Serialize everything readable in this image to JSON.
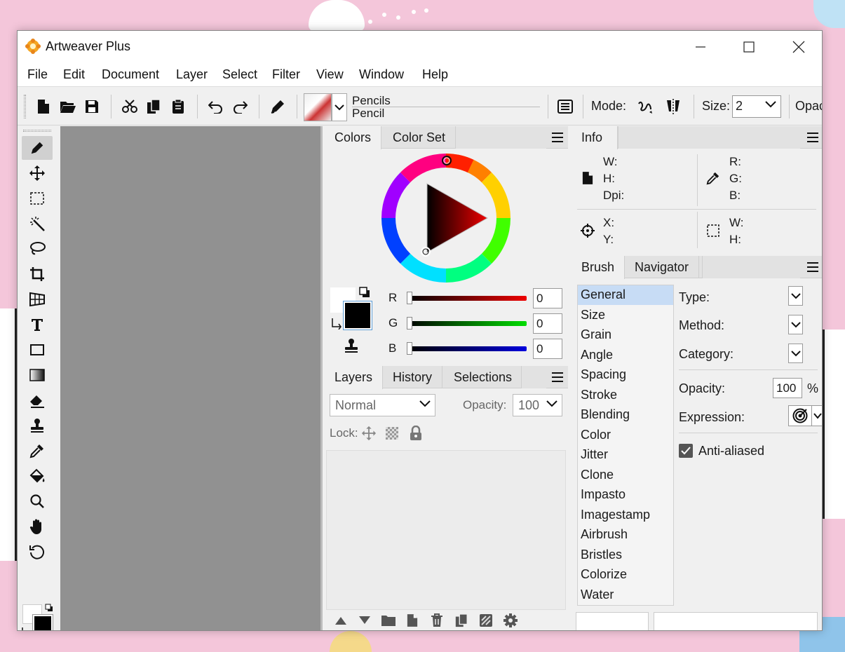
{
  "window": {
    "title": "Artweaver Plus"
  },
  "menu": [
    "File",
    "Edit",
    "Document",
    "Layer",
    "Select",
    "Filter",
    "View",
    "Window",
    "Help"
  ],
  "toolbar": {
    "brush_category": "Pencils",
    "brush_name": "Pencil",
    "mode_label": "Mode:",
    "size_label": "Size:",
    "size_value": "2",
    "opacity_label": "Opac"
  },
  "colors_panel": {
    "tabs": [
      "Colors",
      "Color Set"
    ],
    "r_label": "R",
    "g_label": "G",
    "b_label": "B",
    "r_value": "0",
    "g_value": "0",
    "b_value": "0",
    "foreground": "#000000",
    "background": "#ffffff"
  },
  "layers_panel": {
    "tabs": [
      "Layers",
      "History",
      "Selections"
    ],
    "blend_mode": "Normal",
    "opacity_label": "Opacity:",
    "opacity_value": "100",
    "lock_label": "Lock:"
  },
  "info_panel": {
    "tab": "Info",
    "doc_labels": [
      "W:",
      "H:",
      "Dpi:"
    ],
    "color_labels": [
      "R:",
      "G:",
      "B:"
    ],
    "pos_labels": [
      "X:",
      "Y:"
    ],
    "sel_labels": [
      "W:",
      "H:"
    ]
  },
  "brush_panel": {
    "tabs": [
      "Brush",
      "Navigator"
    ],
    "categories": [
      "General",
      "Size",
      "Grain",
      "Angle",
      "Spacing",
      "Stroke",
      "Blending",
      "Color",
      "Jitter",
      "Clone",
      "Impasto",
      "Imagestamp",
      "Airbrush",
      "Bristles",
      "Colorize",
      "Water"
    ],
    "selected_category": "General",
    "type_label": "Type:",
    "method_label": "Method:",
    "category_label": "Category:",
    "opacity_label": "Opacity:",
    "opacity_value": "100",
    "opacity_unit": "%",
    "expression_label": "Expression:",
    "anti_aliased_label": "Anti-aliased",
    "anti_aliased": true
  }
}
